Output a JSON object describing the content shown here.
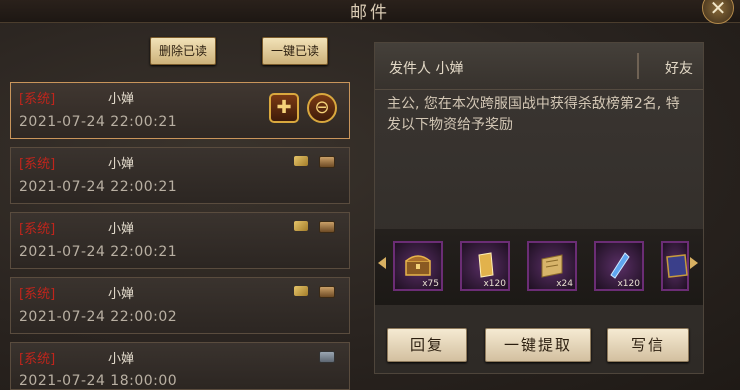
{
  "window": {
    "title": "邮件",
    "close_label": "✕"
  },
  "toolbar": {
    "delete_read_label": "删除已读",
    "mark_all_read_label": "一键已读"
  },
  "mails": [
    {
      "tag": "[系统]",
      "sender": "小婵",
      "date": "2021-07-24 22:00:21"
    },
    {
      "tag": "[系统]",
      "sender": "小婵",
      "date": "2021-07-24 22:00:21"
    },
    {
      "tag": "[系统]",
      "sender": "小婵",
      "date": "2021-07-24 22:00:21"
    },
    {
      "tag": "[系统]",
      "sender": "小婵",
      "date": "2021-07-24 22:00:02"
    },
    {
      "tag": "[系统]",
      "sender": "小婵",
      "date": "2021-07-24 18:00:00"
    }
  ],
  "detail": {
    "sender_label": "发件人 小婵",
    "friend_label": "好友",
    "body": "主公, 您在本次跨服国战中获得杀敌榜第2名, 特发以下物资给予奖励"
  },
  "attachments": [
    {
      "name": "treasure-chest",
      "qty": "x75"
    },
    {
      "name": "gold-token",
      "qty": "x120"
    },
    {
      "name": "scroll",
      "qty": "x24"
    },
    {
      "name": "blue-crystal",
      "qty": "x120"
    }
  ],
  "actions": {
    "reply": "回复",
    "claim_all": "一键提取",
    "write": "写信"
  },
  "colors": {
    "system_tag": "#c0251c",
    "selected_border": "#c9955b",
    "item_border": "#6b2d75"
  }
}
